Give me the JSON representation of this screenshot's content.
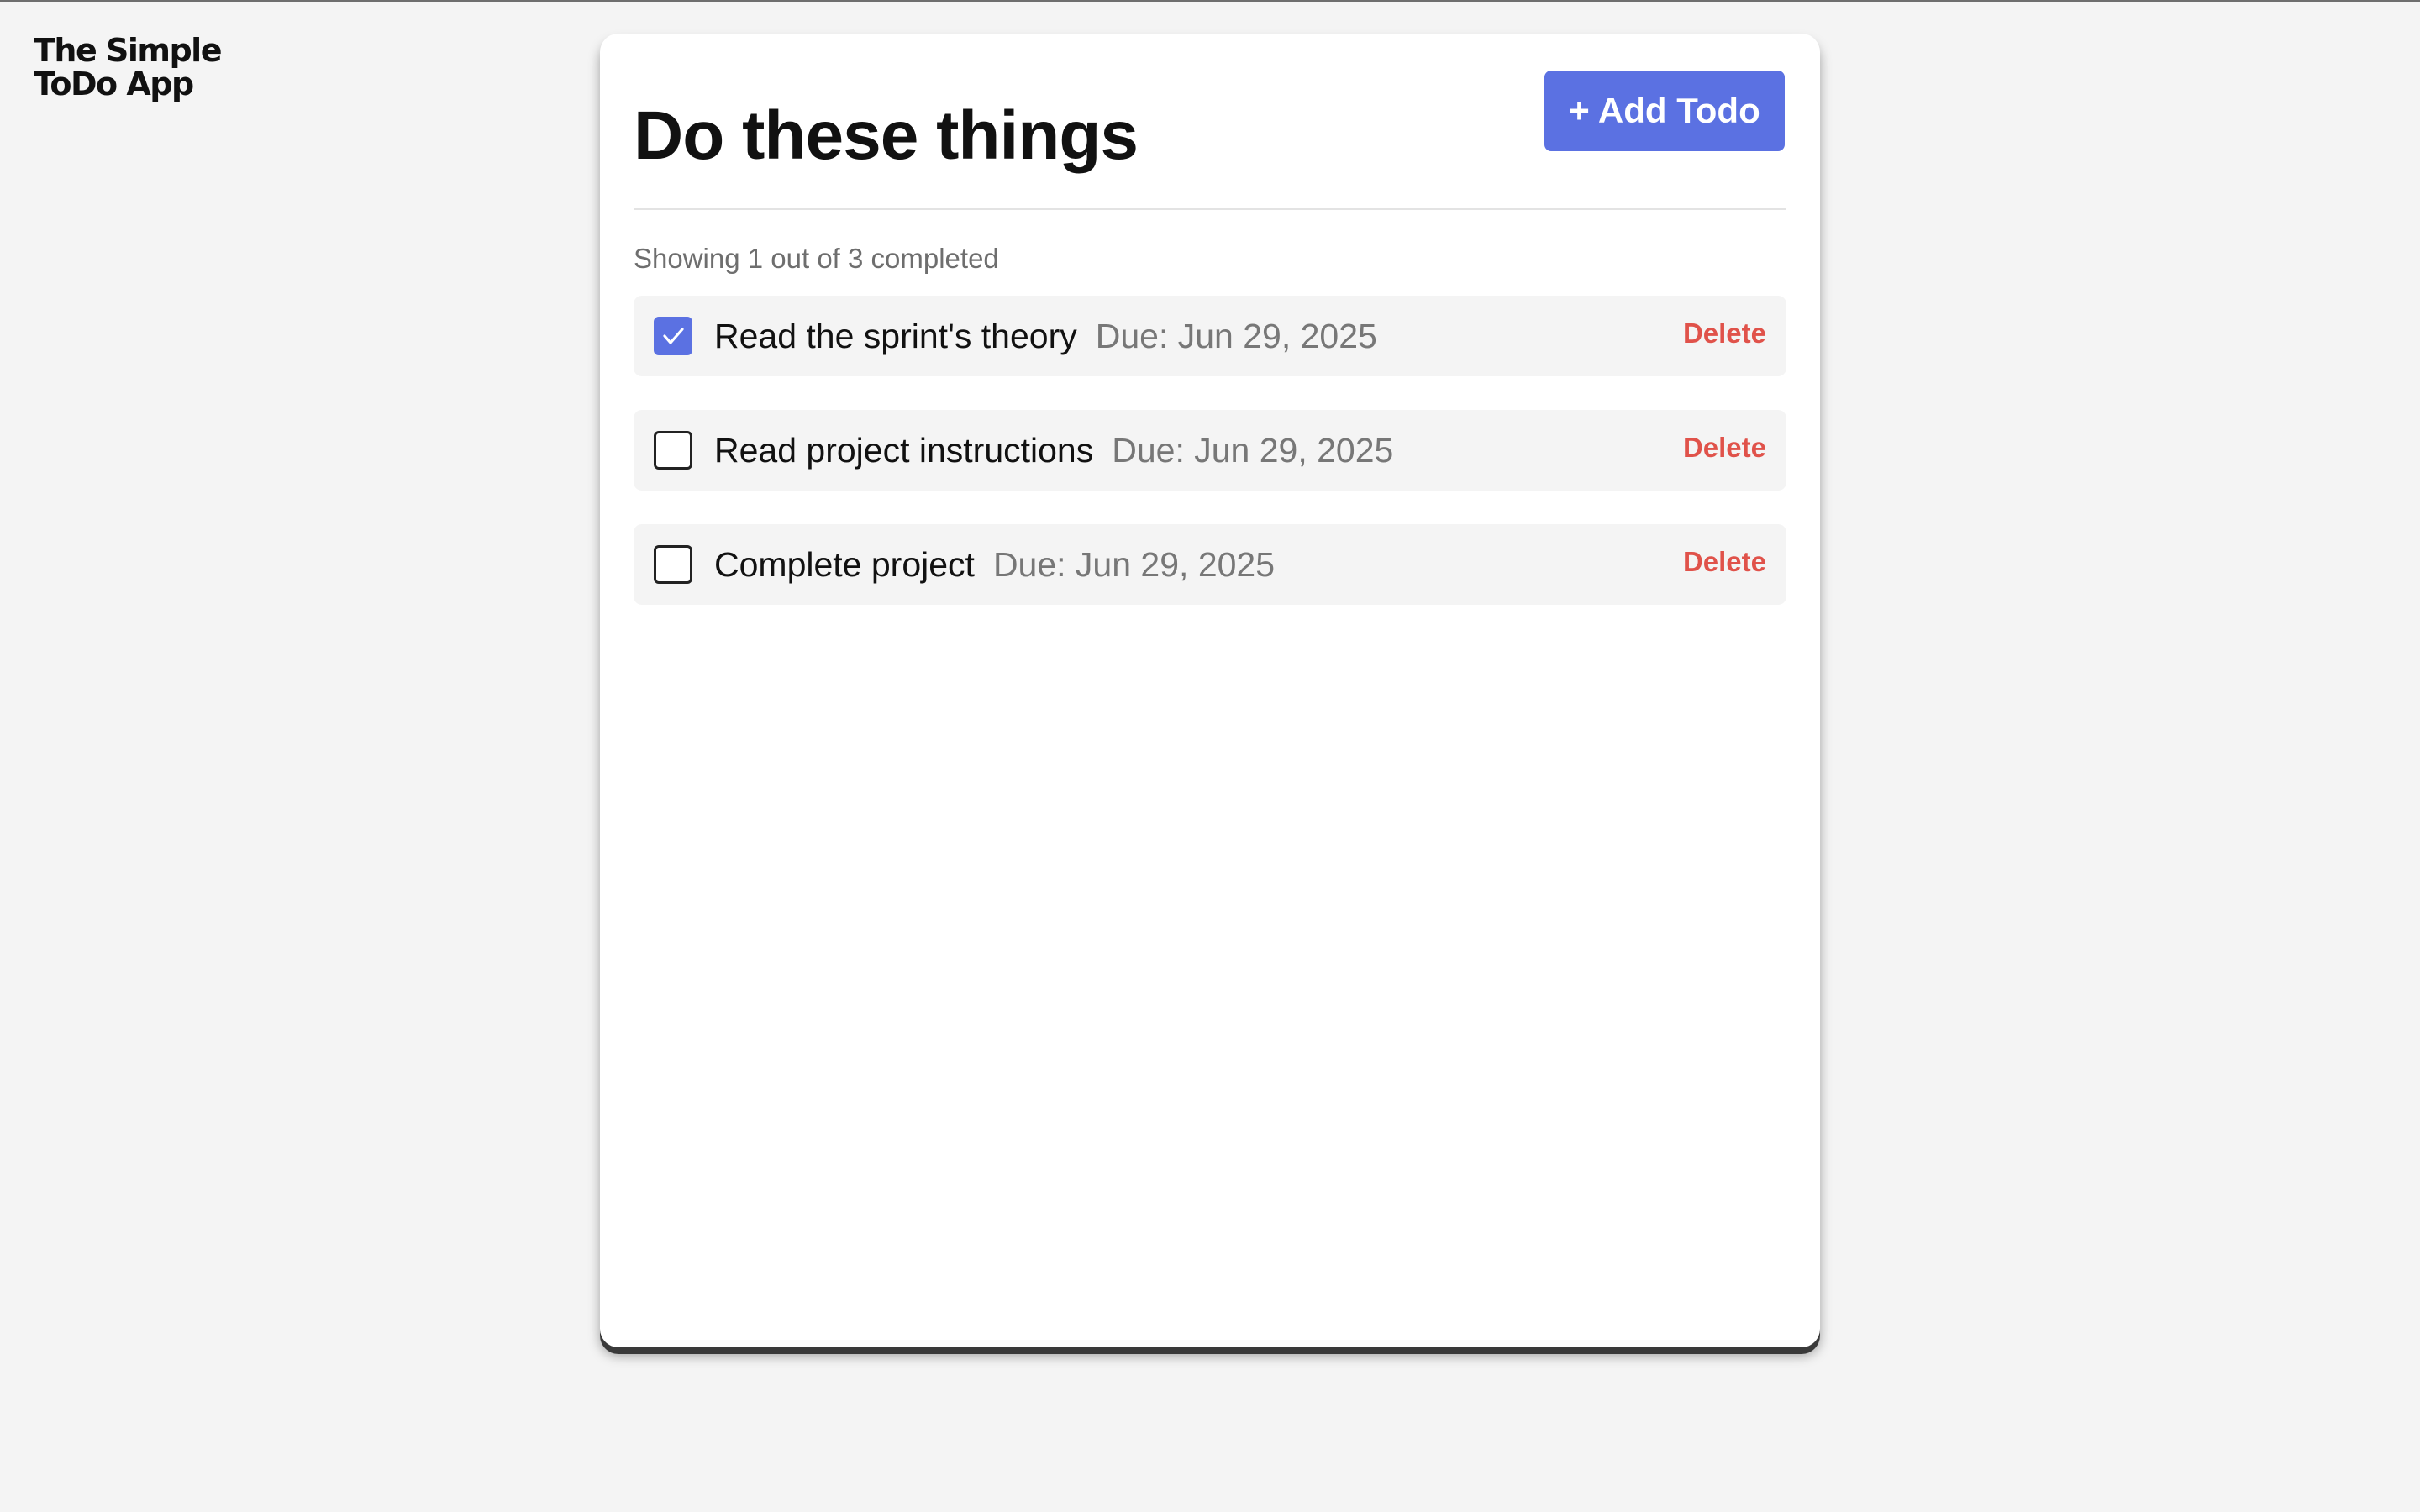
{
  "brand": {
    "line1": "The Simple",
    "line2": "ToDo App"
  },
  "header": {
    "title": "Do these things",
    "add_button_label": "+ Add Todo"
  },
  "status": {
    "text": "Showing 1 out of 3 completed"
  },
  "todos": [
    {
      "title": "Read the sprint's theory",
      "due": "Due: Jun 29, 2025",
      "completed": true,
      "delete_label": "Delete"
    },
    {
      "title": "Read project instructions",
      "due": "Due: Jun 29, 2025",
      "completed": false,
      "delete_label": "Delete"
    },
    {
      "title": "Complete project",
      "due": "Due: Jun 29, 2025",
      "completed": false,
      "delete_label": "Delete"
    }
  ],
  "colors": {
    "accent": "#5b71e2",
    "danger": "#e0524a",
    "page_background": "#f4f4f4",
    "card_background": "#ffffff",
    "item_background": "#f4f4f4",
    "muted_text": "#777777"
  },
  "icons": {
    "checkbox_checked": "checkmark-icon"
  }
}
